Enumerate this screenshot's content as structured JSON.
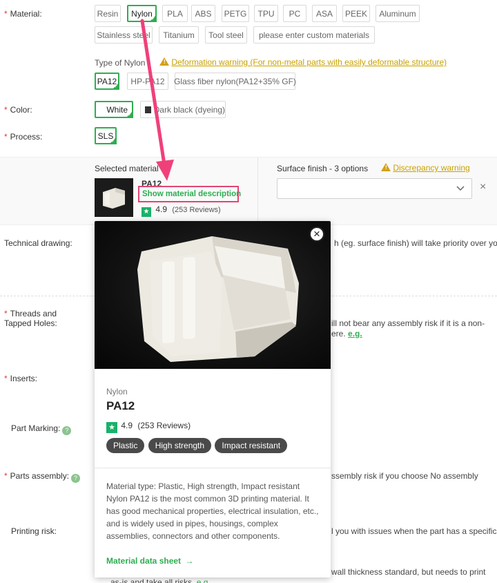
{
  "material": {
    "label": "Material:",
    "options": [
      "Resin",
      "Nylon",
      "PLA",
      "ABS",
      "PETG",
      "TPU",
      "PC",
      "ASA",
      "PEEK",
      "Aluminum",
      "Stainless steel",
      "Titanium",
      "Tool steel",
      "please enter custom materials"
    ],
    "selected": "Nylon",
    "type_label": "Type of Nylon",
    "deformation_warning": "Deformation warning (For non-metal parts with easily deformable structure)",
    "types": [
      "PA12",
      "HP-PA12",
      "Glass fiber nylon(PA12+35% GF)"
    ],
    "type_selected": "PA12"
  },
  "color": {
    "label": "Color:",
    "options": [
      "White",
      "Dark black (dyeing)"
    ],
    "selected": "White"
  },
  "process": {
    "label": "Process:",
    "options": [
      "SLS"
    ],
    "selected": "SLS"
  },
  "selected_material": {
    "heading": "Selected material",
    "name": "PA12",
    "show_description": "Show material description",
    "rating": "4.9",
    "reviews": "(253 Reviews)"
  },
  "surface_finish": {
    "label": "Surface finish - 3 options",
    "discrepancy_warning": "Discrepancy warning",
    "close": "×"
  },
  "form_rows": {
    "technical_drawing": "Technical drawing:",
    "technical_drawing_text": "h (eg. surface finish) will take priority over your",
    "threads": "Threads and\nTapped Holes:",
    "threads_text1": "ill not bear any assembly risk if it is a non-",
    "threads_text2": "ere.",
    "eg": "e.g.",
    "inserts": "Inserts:",
    "part_marking": "Part Marking:",
    "parts_assembly": "Parts assembly:",
    "parts_assembly_text": "ssembly risk if you choose No assembly",
    "printing_risk": "Printing risk:",
    "printing_risk_text1": "l you with issues when the part has a specific",
    "printing_risk_text2": "wall thickness standard, but needs to print",
    "printing_risk_text3": "as-is and take all risks.",
    "eg2": "e.g."
  },
  "popup": {
    "category": "Nylon",
    "title": "PA12",
    "rating": "4.9",
    "reviews": "(253 Reviews)",
    "tags": [
      "Plastic",
      "High strength",
      "Impact resistant"
    ],
    "description": "Material type: Plastic, High strength, Impact resistant Nylon PA12 is the most common 3D printing material. It has good mechanical properties, electrical insulation, etc., and is widely used in pipes, housings, complex assemblies, connectors and other components.",
    "datasheet": "Material data sheet",
    "close": "×"
  },
  "colors": {
    "accent_green": "#2ead50",
    "warning_yellow": "#c9a100",
    "annotation_pink": "#f0407a"
  }
}
